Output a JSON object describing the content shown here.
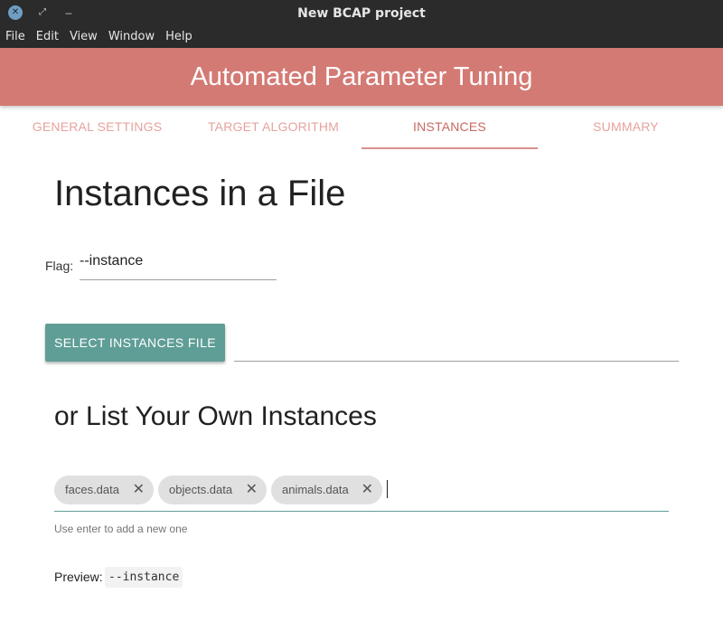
{
  "window": {
    "title": "New BCAP project",
    "controls": {
      "close_icon": "close-icon",
      "maximize_icon": "maximize-icon",
      "minimize_icon": "minimize-icon"
    }
  },
  "menubar": {
    "items": [
      "File",
      "Edit",
      "View",
      "Window",
      "Help"
    ]
  },
  "header": {
    "title": "Automated Parameter Tuning",
    "color": "#d47a74"
  },
  "tabs": [
    {
      "label": "GENERAL SETTINGS",
      "active": false
    },
    {
      "label": "TARGET ALGORITHM",
      "active": false
    },
    {
      "label": "INSTANCES",
      "active": true
    },
    {
      "label": "SUMMARY",
      "active": false
    }
  ],
  "content": {
    "file_heading": "Instances in a File",
    "flag_label": "Flag:",
    "flag_value": "--instance",
    "select_button": "SELECT INSTANCES FILE",
    "selected_file": "",
    "list_heading": "or List Your Own Instances",
    "chips": [
      "faces.data",
      "objects.data",
      "animals.data"
    ],
    "chip_remove_glyph": "✕",
    "helper_text": "Use enter to add a new one",
    "preview_label": "Preview:",
    "preview_value": "--instance"
  },
  "colors": {
    "accent": "#5f9e96",
    "tab_text": "#e6a39e",
    "tab_active": "#c96861"
  }
}
